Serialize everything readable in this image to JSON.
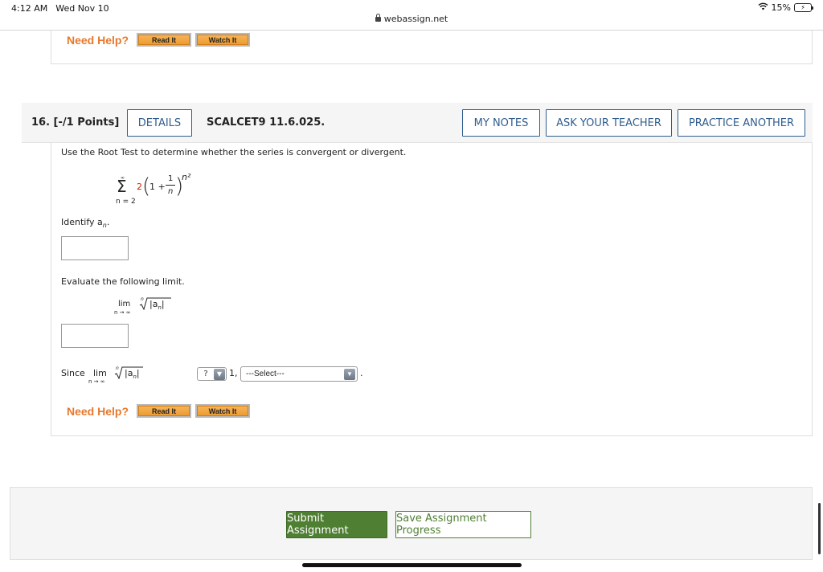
{
  "status_bar": {
    "time": "4:12 AM",
    "date": "Wed Nov 10",
    "url": "webassign.net",
    "battery": "15%"
  },
  "prev_help": {
    "label": "Need Help?",
    "read_it": "Read It",
    "watch_it": "Watch It"
  },
  "question": {
    "number": "16. [-/1 Points]",
    "details_btn": "DETAILS",
    "code": "SCALCET9 11.6.025.",
    "my_notes_btn": "MY NOTES",
    "ask_teacher_btn": "ASK YOUR TEACHER",
    "practice_btn": "PRACTICE ANOTHER",
    "prompt": "Use the Root Test to determine whether the series is convergent or divergent.",
    "series": {
      "upper": "∞",
      "sigma": "Σ",
      "lower": "n = 2",
      "coef": "2",
      "one_plus": "1 +",
      "num": "1",
      "den": "n",
      "exp": "n²"
    },
    "identify_label": "Identify a",
    "identify_sub": "n",
    "identify_period": ".",
    "evaluate_label": "Evaluate the following limit.",
    "limit": {
      "lim": "lim",
      "under": "n → ∞",
      "root_index": "n",
      "abs": "|a",
      "abs_sub": "n",
      "abs_close": "|"
    },
    "since_label": "Since",
    "compare_select": "?",
    "one_comma": "1,",
    "conclusion_select": "---Select---",
    "end_period": ".",
    "help": {
      "label": "Need Help?",
      "read_it": "Read It",
      "watch_it": "Watch It"
    }
  },
  "footer": {
    "submit": "Submit Assignment",
    "save": "Save Assignment Progress"
  },
  "colors": {
    "help_orange": "#e8782b",
    "button_blue": "#2f5d8e",
    "submit_green": "#4f7f33",
    "red_coef": "#cc2200"
  }
}
